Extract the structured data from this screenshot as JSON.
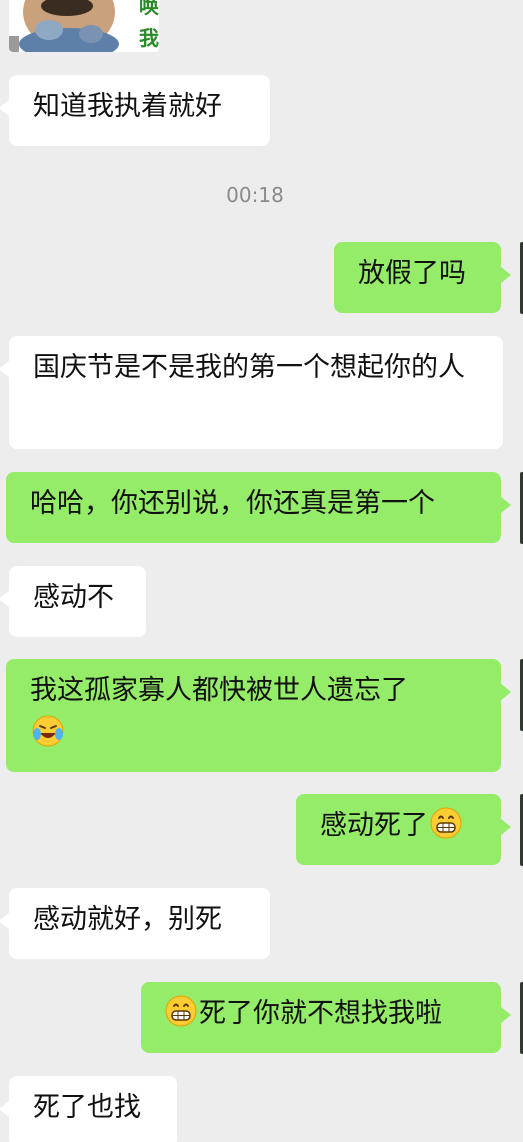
{
  "sticker": {
    "char_top": "唤",
    "char_bottom": "我"
  },
  "timestamp": "00:18",
  "messages": [
    {
      "side": "left",
      "text": "知道我执着就好"
    },
    {
      "side": "right",
      "text": "放假了吗"
    },
    {
      "side": "left",
      "text": "国庆节是不是我的第一个想起你的人"
    },
    {
      "side": "right",
      "text": "哈哈，你还别说，你还真是第一个"
    },
    {
      "side": "left",
      "text": "感动不"
    },
    {
      "side": "right",
      "text": "我这孤家寡人都快被世人遗忘了",
      "emoji_after": "laughing-tears-emoji"
    },
    {
      "side": "right",
      "text": "感动死了",
      "emoji_after": "grinning-emoji"
    },
    {
      "side": "left",
      "text": "感动就好，别死"
    },
    {
      "side": "right",
      "text": "死了你就不想找我啦",
      "emoji_before": "grinning-emoji"
    },
    {
      "side": "left",
      "text": "死了也找"
    }
  ],
  "colors": {
    "background": "#ededed",
    "sent_bubble": "#95ec69",
    "received_bubble": "#ffffff",
    "timestamp_text": "#8a8a8a"
  }
}
